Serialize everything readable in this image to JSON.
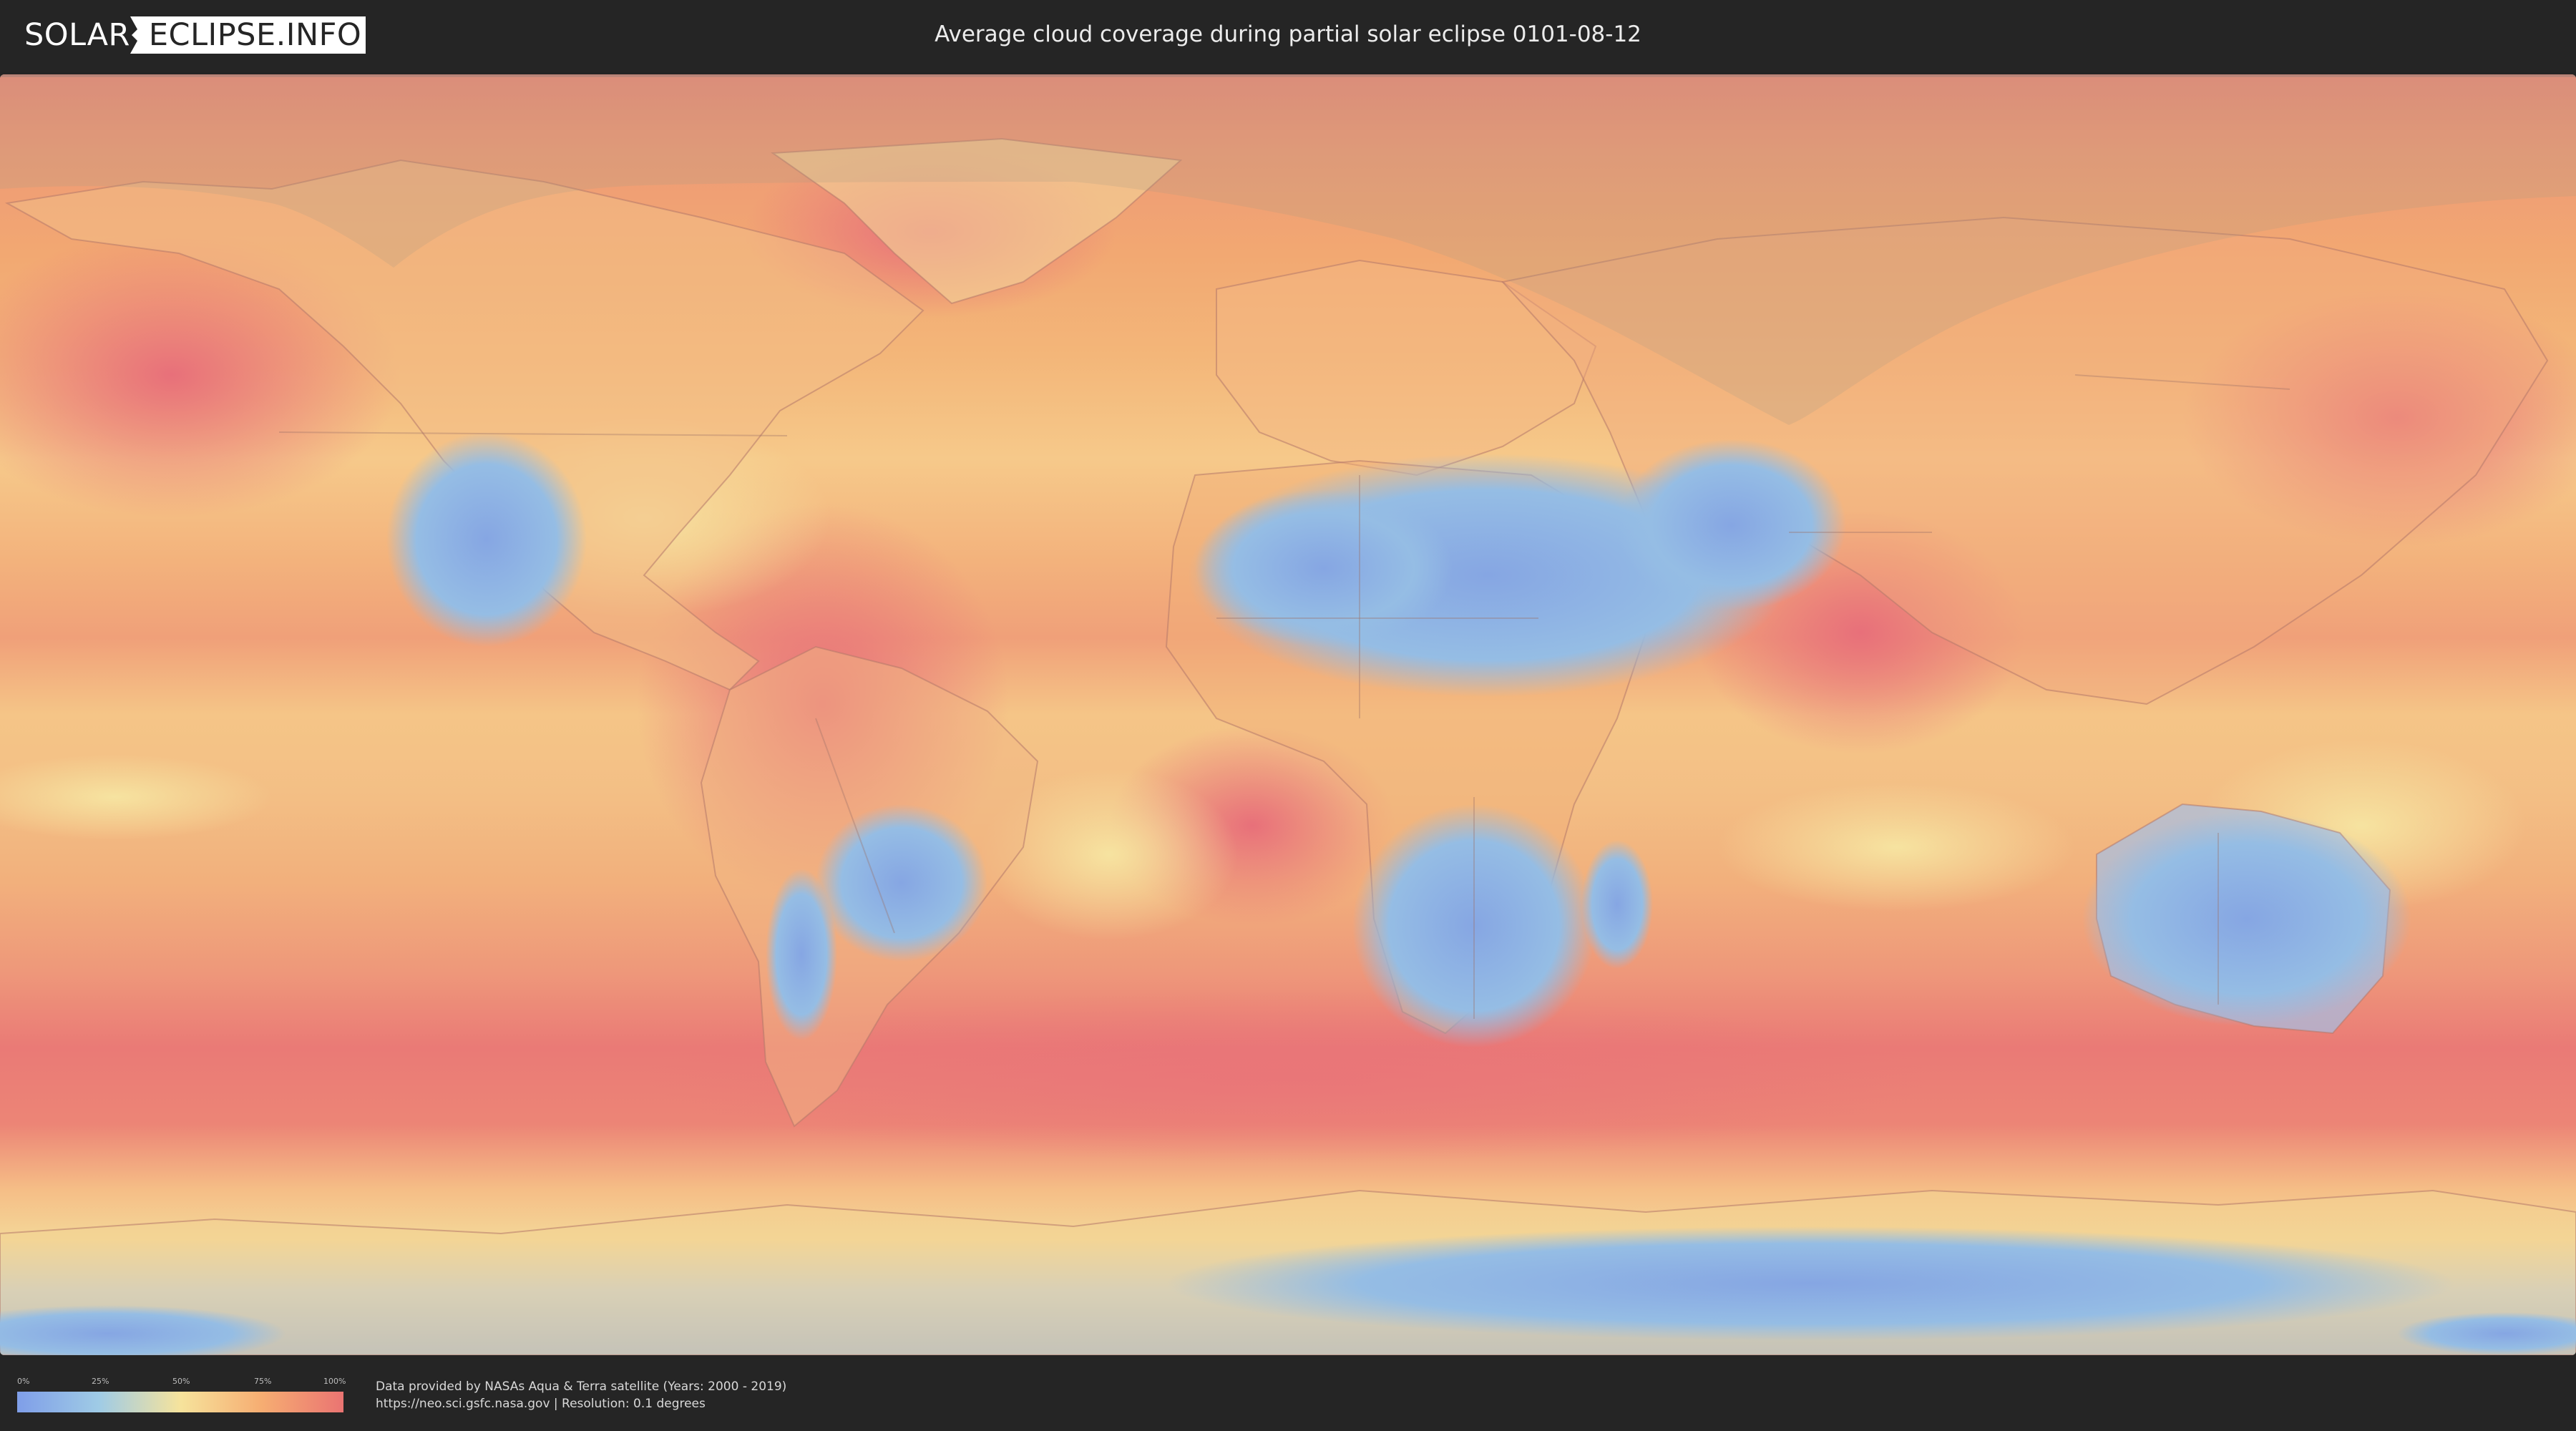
{
  "header": {
    "logo_text_left": "SOLAR",
    "logo_text_right": "ECLIPSE.INFO",
    "title": "Average cloud coverage during partial solar eclipse 0101-08-12"
  },
  "map": {
    "projection": "equirectangular world map",
    "layers": [
      "cloud coverage",
      "country borders",
      "eclipse visibility zone"
    ],
    "colors": {
      "low": "#7f9ee8",
      "mid_low": "#9fcbe6",
      "mid": "#f6e39c",
      "mid_high": "#f6ad72",
      "high": "#ea7472",
      "eclipse_shade": "#bfa98a"
    }
  },
  "legend": {
    "ticks": [
      "0%",
      "25%",
      "50%",
      "75%",
      "100%"
    ],
    "tick_values": [
      0,
      25,
      50,
      75,
      100
    ]
  },
  "footer": {
    "source_line": "Data provided by NASAs Aqua & Terra satellite (Years: 2000 - 2019)",
    "url_line": "https://neo.sci.gsfc.nasa.gov | Resolution: 0.1 degrees"
  }
}
